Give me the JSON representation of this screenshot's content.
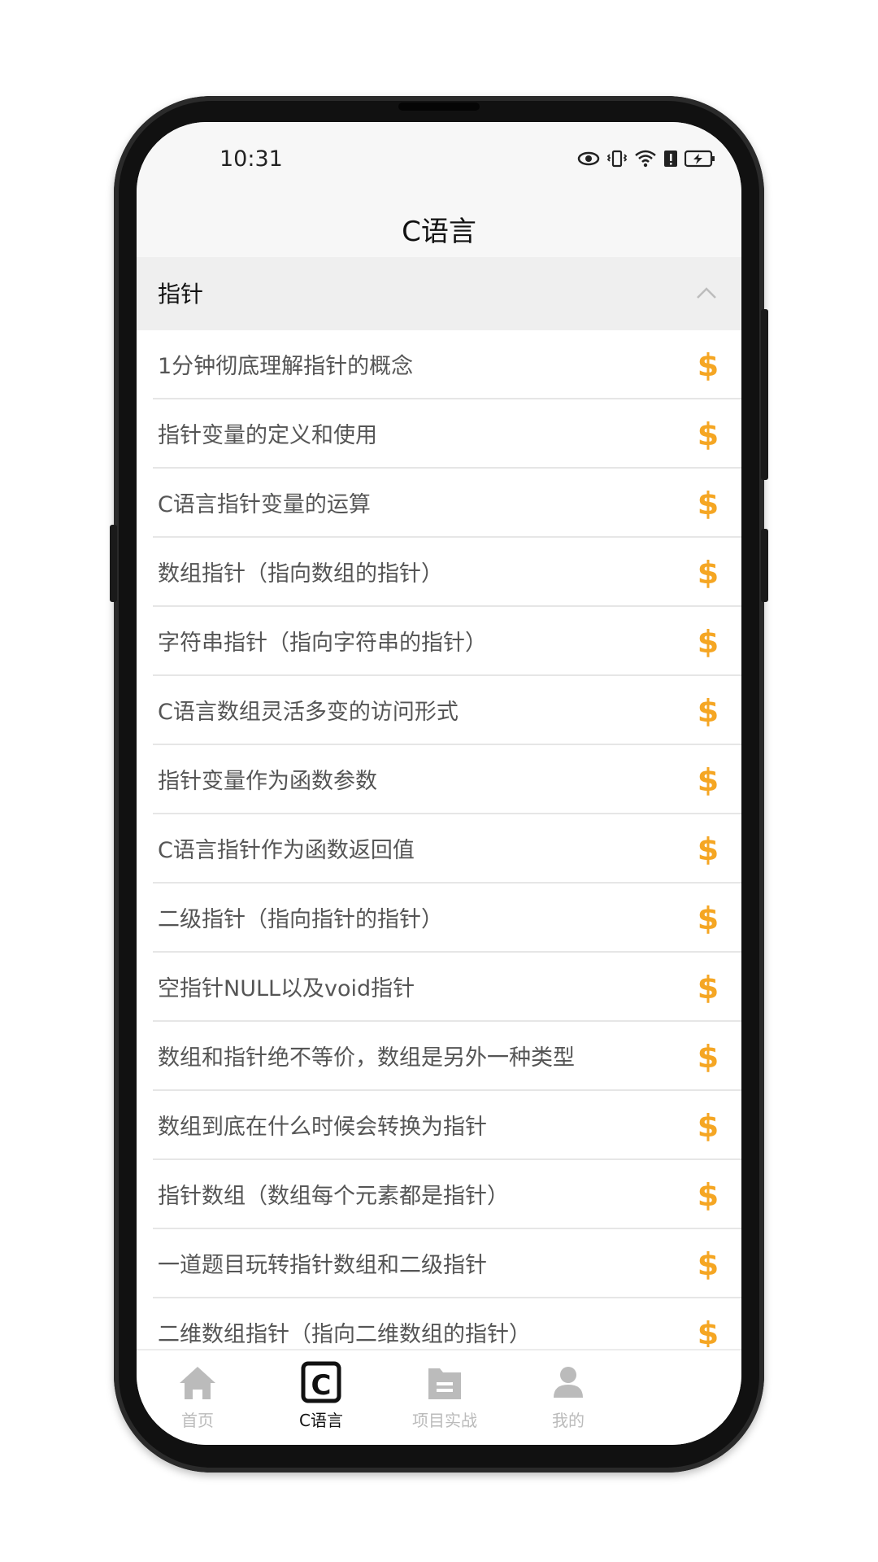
{
  "status_bar": {
    "time": "10:31",
    "icons": [
      "eye-icon",
      "vibrate-icon",
      "wifi-icon",
      "alert-icon",
      "battery-charging-icon"
    ]
  },
  "header": {
    "title": "C语言"
  },
  "section": {
    "title": "指针",
    "expanded": true
  },
  "lessons": [
    {
      "label": "1分钟彻底理解指针的概念",
      "icon": "coin-icon"
    },
    {
      "label": "指针变量的定义和使用",
      "icon": "coin-icon"
    },
    {
      "label": "C语言指针变量的运算",
      "icon": "coin-icon"
    },
    {
      "label": "数组指针（指向数组的指针）",
      "icon": "coin-icon"
    },
    {
      "label": "字符串指针（指向字符串的指针）",
      "icon": "coin-icon"
    },
    {
      "label": "C语言数组灵活多变的访问形式",
      "icon": "coin-icon"
    },
    {
      "label": "指针变量作为函数参数",
      "icon": "coin-icon"
    },
    {
      "label": "C语言指针作为函数返回值",
      "icon": "coin-icon"
    },
    {
      "label": "二级指针（指向指针的指针）",
      "icon": "coin-icon"
    },
    {
      "label": "空指针NULL以及void指针",
      "icon": "coin-icon"
    },
    {
      "label": "数组和指针绝不等价，数组是另外一种类型",
      "icon": "coin-icon"
    },
    {
      "label": "数组到底在什么时候会转换为指针",
      "icon": "coin-icon"
    },
    {
      "label": "指针数组（数组每个元素都是指针）",
      "icon": "coin-icon"
    },
    {
      "label": "一道题目玩转指针数组和二级指针",
      "icon": "coin-icon"
    },
    {
      "label": "二维数组指针（指向二维数组的指针）",
      "icon": "coin-icon"
    }
  ],
  "tabbar": {
    "tabs": [
      {
        "label": "首页",
        "icon": "home-icon",
        "active": false
      },
      {
        "label": "C语言",
        "icon": "c-language-icon",
        "active": true
      },
      {
        "label": "项目实战",
        "icon": "folder-icon",
        "active": false
      },
      {
        "label": "我的",
        "icon": "user-icon",
        "active": false
      }
    ]
  },
  "colors": {
    "accent_coin": "#f5a623",
    "tab_inactive": "#bbbbbb",
    "tab_active": "#111111",
    "header_bg": "#f7f7f7",
    "section_bg": "#efefef"
  }
}
